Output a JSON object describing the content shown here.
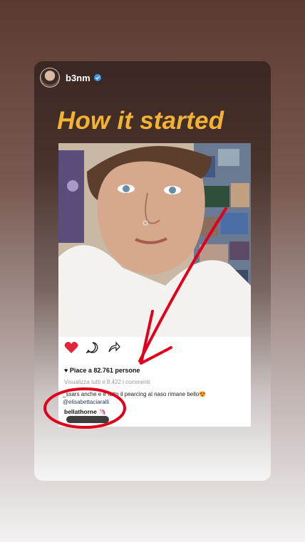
{
  "story": {
    "username": "b3nm",
    "verified": true,
    "headline": "How it started"
  },
  "post": {
    "likes_text": "Piace a 82.761 persone",
    "view_comments": "Visualizza tutti e 8.422 i commenti",
    "comment_text_left": "_ssars anche e",
    "comment_text_right": "è fatto il pearcing al naso rimane bello😍",
    "comment_mention": "@elisabettaciaralli",
    "comment2_user": "bellathorne",
    "comment2_emoji": "🦄"
  },
  "icons": [
    "heart-icon",
    "comment-icon",
    "share-icon",
    "verified-badge-icon"
  ],
  "colors": {
    "headline": "#f2b233",
    "annotation_red": "#e0001b",
    "heart_red": "#e0263b",
    "verified_blue": "#3897f0"
  }
}
